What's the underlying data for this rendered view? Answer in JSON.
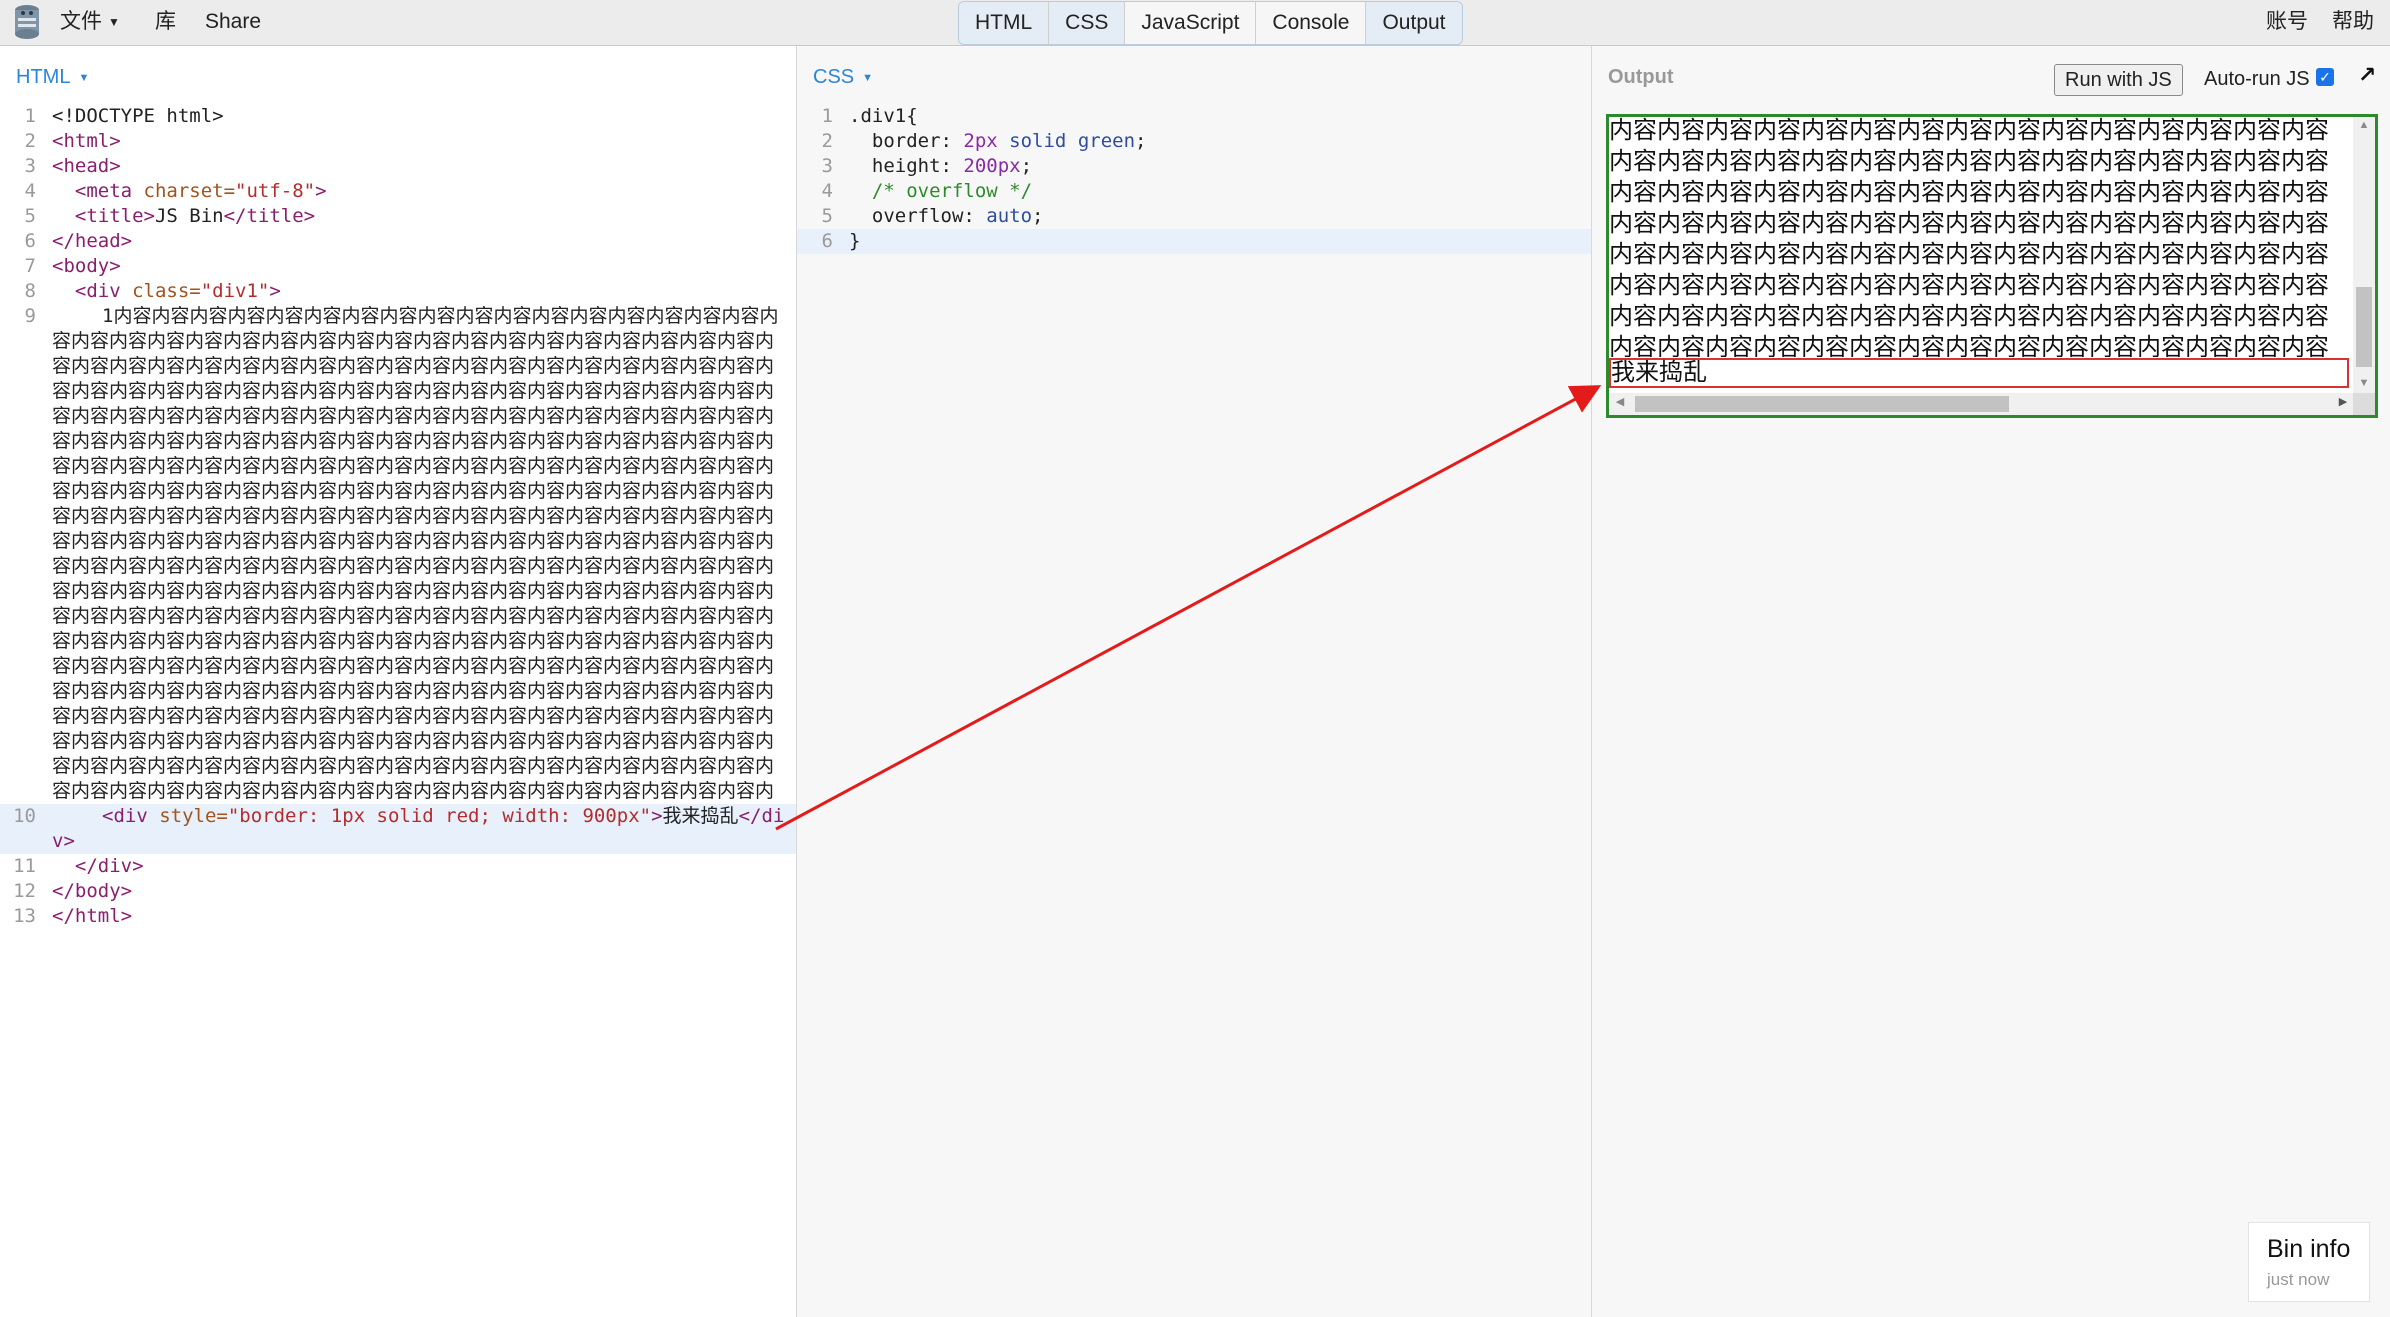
{
  "topbar": {
    "menu": [
      {
        "label": "文件"
      },
      {
        "label": "库"
      },
      {
        "label": "Share"
      }
    ],
    "panel_tabs": [
      "HTML",
      "CSS",
      "JavaScript",
      "Console",
      "Output"
    ],
    "right": {
      "account": "账号",
      "help": "帮助"
    }
  },
  "html_panel": {
    "label": "HTML",
    "lines": {
      "l1": "<!DOCTYPE html>",
      "l2_tag": "<html>",
      "l3_tag": "<head>",
      "l4_open": "<meta ",
      "l4_attr": "charset=",
      "l4_str": "\"utf-8\"",
      "l4_close": ">",
      "l5_open": "<title>",
      "l5_text": "JS Bin",
      "l5_close": "</title>",
      "l6_tag": "</head>",
      "l7_tag": "<body>",
      "l8_open": "<div ",
      "l8_attr": "class=",
      "l8_str": "\"div1\"",
      "l8_close": ">",
      "l9_text": "1内容内容内容内容内容内容内容内容内容内容内容内容内容内容内容内容内容内容内容内容内容内容内容内容内容内容内容内容内容内容内容内容内容内容内容内容内容内容内容内容内容内容内容内容内容内容内容内容内容内容内容内容内容内容内容内容内容内容内容内容内容内容内容内容内容内容内容内容内容内容内容内容内容内容内容内容内容内容内容内容内容内容内容内容内容内容内容内容内容内容内容内容内容内容内容内容内容内容内容内容内容内容内容内容内容内容内容内容内容内容内容内容内容内容内容内容内容内容内容内容内容内容内容内容内容内容内容内容内容内容内容内容内容内容内容内容内容内容内容内容内容内容内容内容内容内容内容内容内容内容内容内容内容内容内容内容内容内容内容内容内容内容内容内容内容内容内容内容内容内容内容内容内容内容内容内容内容内容内容内容内容内容内容内容内容内容内容内容内容内容内容内容内容内容内容内容内容内容内容内容内容内容内容内容内容内容内容内容内容内容内容内容内容内容内容内容内容内容内容内容内容内容内容内容内容内容内容内容内容内容内容内容内容内容内容内容内容内容内容内容内容内容内容内容内容内容内容内容内容内容内容内容内容内容内容内容内容内容内容内容内容内容内容内容内容内容内容内容内容内容内容内容内容内容内容内容内容内容内容内容内容内容内容内容内容内容内容内容内容内容内容内容内容内容内容内容内容内容内容内容内容内容内容内容内容内容内容内容内容内容内容内容内容内容内容内容内容内容内容内容内容内容内容内容内容内容内容内容内容内容内容内容内容内容内容内容内容内容内容内容内容内容内容内容内容内容内容内容内容内容内容内容内容内容内容内容内容内容内容内容内容内容内容内容内容内容内容内容内容内容内容内容内容内容内容内容内容内容内容",
      "l10_open": "<div ",
      "l10_attr": "style=",
      "l10_str": "\"border: 1px solid red; width: 900px\"",
      "l10_mid": ">",
      "l10_text": "我来捣乱",
      "l10_close": "</div>",
      "l11_tag": "</div>",
      "l12_tag": "</body>",
      "l13_tag": "</html>"
    }
  },
  "css_panel": {
    "label": "CSS",
    "lines": {
      "l1": ".div1{",
      "l2_prop": "border: ",
      "l2_num": "2px",
      "l2_kw": " solid ",
      "l2_color": "green",
      "l2_end": ";",
      "l3_prop": "height: ",
      "l3_num": "200px",
      "l3_end": ";",
      "l4_cmt": "/* overflow */",
      "l5_prop": "overflow: ",
      "l5_kw": "auto",
      "l5_end": ";",
      "l6": "}"
    }
  },
  "output_panel": {
    "label": "Output",
    "run_button": "Run with JS",
    "autorun_label": "Auto-run JS",
    "autorun_checked": true,
    "demo_text": "内容内容内容内容内容内容内容内容内容内容内容内容内容内容内容内容内容内容内容内容内容内容内容内容内容内容内容内容内容内容内容内容内容内容内容内容内容内容内容内容内容内容内容内容内容内容内容内容内容内容内容内容内容内容内容内容内容内容内容内容内容内容内容内容内容内容内容内容内容内容内容内容内容内容内容内容内容内容内容内容内容内容内容内容内容内容内容内容内容内容内容内容内容内容内容内容内容内容内容内容内容内容内容内容内容内容内容内容内容内容内容内容内容内容内容内容内容内容内容内容内容内容内容内容内容内容内容内容内容内容内容内容内容内容",
    "demo_red_text": "我来捣乱",
    "border_color": "#2c8a2c",
    "red_color": "#d83232"
  },
  "bin_info": {
    "title": "Bin info",
    "subtitle": "just now"
  },
  "line_numbers": {
    "html": [
      "1",
      "2",
      "3",
      "4",
      "5",
      "6",
      "7",
      "8",
      "9",
      "10",
      "11",
      "12",
      "13"
    ],
    "css": [
      "1",
      "2",
      "3",
      "4",
      "5",
      "6"
    ]
  }
}
